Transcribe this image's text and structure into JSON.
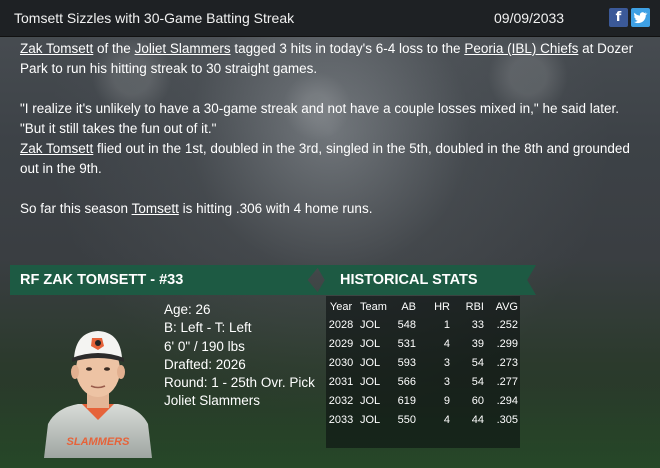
{
  "header": {
    "headline": "Tomsett Sizzles with 30-Game Batting Streak",
    "date": "09/09/2033",
    "facebook_icon": "facebook-icon",
    "twitter_icon": "twitter-icon"
  },
  "article": {
    "p1": {
      "player": "Zak Tomsett",
      "t1": " of the ",
      "team": "Joliet Slammers",
      "t2": " tagged 3 hits in today's 6-4 loss to the ",
      "opponent": "Peoria (IBL) Chiefs",
      "t3": " at Dozer Park to run his hitting streak to 30 straight games."
    },
    "quote": "\"I realize it's unlikely to have a 30-game streak and not have a couple losses mixed in,\" he said later. \"But it still takes the fun out of it.\"",
    "p3": {
      "player": "Zak Tomsett",
      "text": " flied out in the 1st, doubled in the 3rd, singled in the 5th, doubled in the 8th and grounded out in the 9th."
    },
    "p4": {
      "t1": "So far this season ",
      "player": "Tomsett",
      "t2": " is hitting .306 with 4 home runs."
    }
  },
  "player": {
    "ribbon": "RF ZAK TOMSETT - #33",
    "age": "Age: 26",
    "bats_throws": "B: Left - T: Left",
    "height_weight": "6' 0\" / 190 lbs",
    "drafted": "Drafted: 2026",
    "round": "Round: 1 - 25th Ovr. Pick",
    "team": "Joliet Slammers",
    "jersey_text": "SLAMMERS"
  },
  "stats": {
    "ribbon": "HISTORICAL STATS",
    "headers": [
      "Year",
      "Team",
      "AB",
      "HR",
      "RBI",
      "AVG"
    ],
    "rows": [
      [
        "2028",
        "JOL",
        "548",
        "1",
        "33",
        ".252"
      ],
      [
        "2029",
        "JOL",
        "531",
        "4",
        "39",
        ".299"
      ],
      [
        "2030",
        "JOL",
        "593",
        "3",
        "54",
        ".273"
      ],
      [
        "2031",
        "JOL",
        "566",
        "3",
        "54",
        ".277"
      ],
      [
        "2032",
        "JOL",
        "619",
        "9",
        "60",
        ".294"
      ],
      [
        "2033",
        "JOL",
        "550",
        "4",
        "44",
        ".305"
      ]
    ]
  },
  "colors": {
    "ribbon": "#1d5a43",
    "header_bg": "#1e2124",
    "facebook": "#3b5998",
    "twitter": "#3ea0e4"
  }
}
